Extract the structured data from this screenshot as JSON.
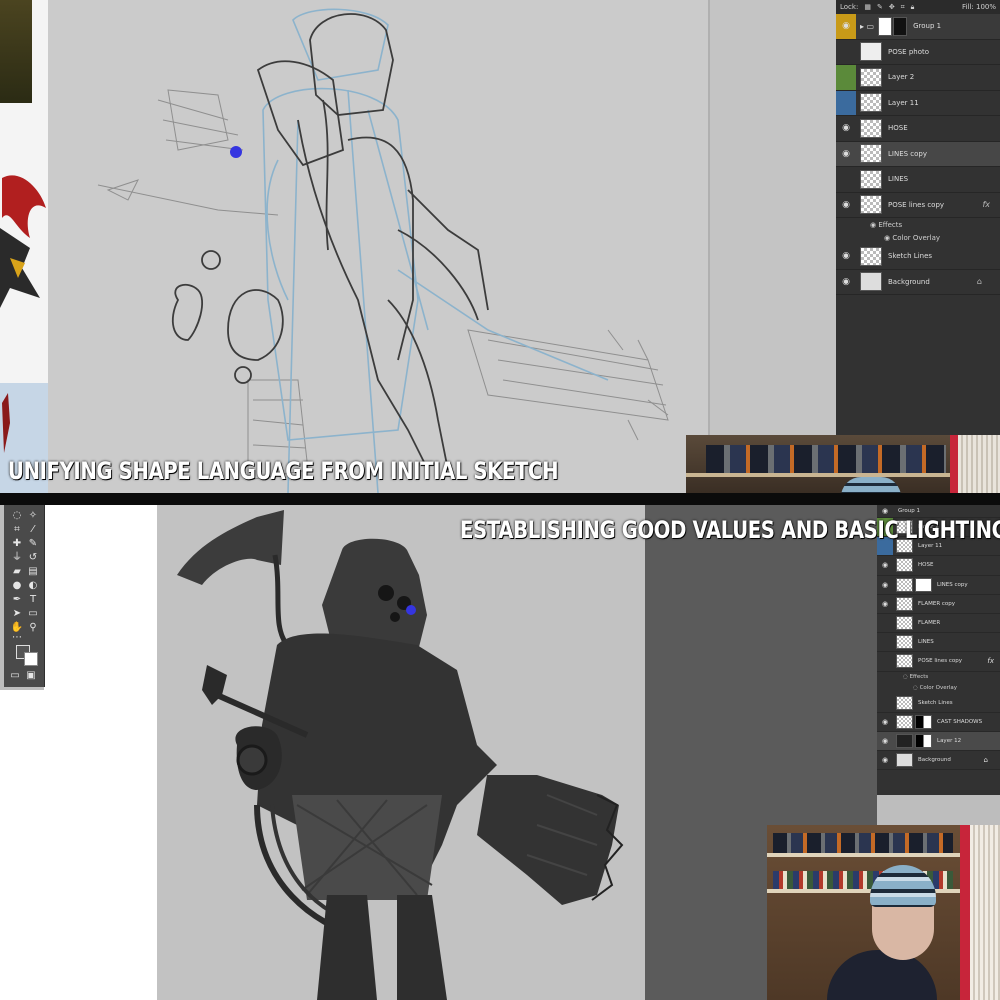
{
  "captions": {
    "top": "UNIFYING SHAPE LANGUAGE FROM INITIAL SKETCH",
    "bottom": "ESTABLISHING GOOD VALUES AND BASIC LIGHTING"
  },
  "top_layers": {
    "lock_label": "Lock:",
    "fill_label": "Fill:",
    "fill_value": "100%",
    "layers": [
      {
        "name": "Group 1",
        "eye": true,
        "kind": "group"
      },
      {
        "name": "POSE photo",
        "eye": false
      },
      {
        "name": "Layer 2",
        "eye": false,
        "color": "green"
      },
      {
        "name": "Layer 11",
        "eye": false,
        "color": "blue"
      },
      {
        "name": "HOSE",
        "eye": true
      },
      {
        "name": "LINES copy",
        "eye": true,
        "selected": true
      },
      {
        "name": "LINES",
        "eye": false
      },
      {
        "name": "POSE lines copy",
        "eye": true,
        "fx": "fx"
      },
      {
        "name": "Sketch Lines",
        "eye": true
      },
      {
        "name": "Background",
        "eye": true,
        "locked": true
      }
    ],
    "effects_label": "Effects",
    "color_overlay_label": "Color Overlay"
  },
  "bottom_layers": {
    "group_label": "Group 1",
    "layers": [
      {
        "name": "Layer 2",
        "eye": false,
        "color": "green"
      },
      {
        "name": "Layer 11",
        "eye": false,
        "color": "blue"
      },
      {
        "name": "HOSE",
        "eye": true
      },
      {
        "name": "LINES copy",
        "eye": true
      },
      {
        "name": "FLAMER copy",
        "eye": true
      },
      {
        "name": "FLAMER",
        "eye": false
      },
      {
        "name": "LINES",
        "eye": false
      },
      {
        "name": "POSE lines copy",
        "eye": false,
        "fx": "fx"
      },
      {
        "name": "Sketch Lines",
        "eye": false
      },
      {
        "name": "CAST SHADOWS",
        "eye": true
      },
      {
        "name": "Layer 12",
        "eye": true,
        "selected": true
      },
      {
        "name": "Background",
        "eye": true,
        "locked": true
      }
    ],
    "effects_label": "Effects",
    "color_overlay_label": "Color Overlay"
  },
  "tools": [
    "lasso",
    "magic-wand",
    "crop",
    "eyedropper",
    "healing-brush",
    "brush",
    "clone-stamp",
    "history-brush",
    "eraser",
    "gradient",
    "blur",
    "dodge",
    "pen",
    "type",
    "path-select",
    "shape",
    "hand",
    "zoom",
    "more"
  ],
  "colors": {
    "group_tag": "#c89a18",
    "green_tag": "#5b8a3a",
    "blue_tag": "#3b6b9e",
    "panel_bg": "#323232",
    "brush_cursor": "#3535e0"
  }
}
